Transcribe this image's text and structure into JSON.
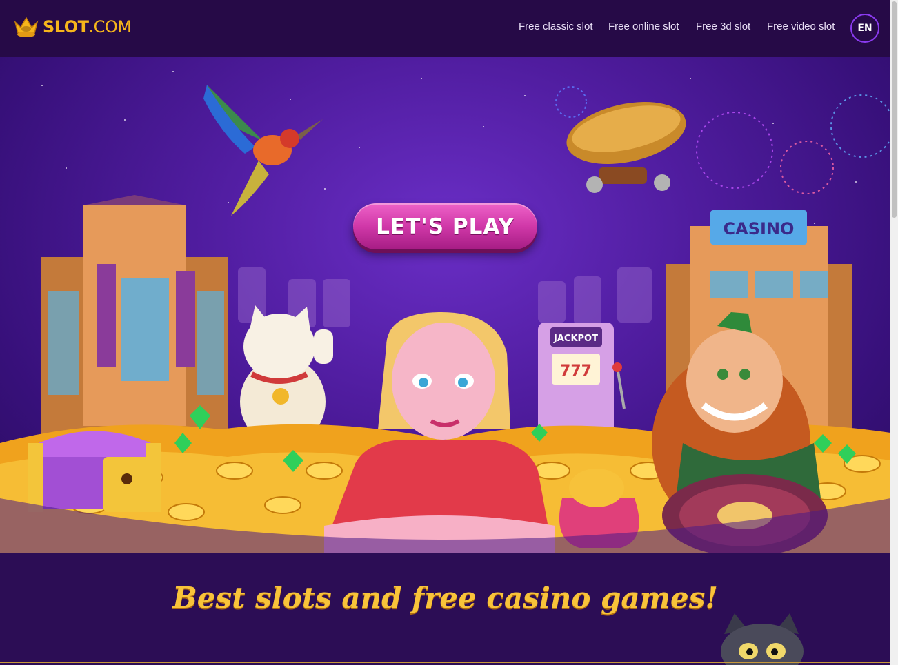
{
  "header": {
    "logo_text_bold": "SLOT",
    "logo_text_rest": ".COM",
    "nav": [
      {
        "label": "Free classic slot"
      },
      {
        "label": "Free online slot"
      },
      {
        "label": "Free 3d slot"
      },
      {
        "label": "Free video slot"
      }
    ],
    "language": "EN"
  },
  "hero": {
    "cta_label": "LET'S PLAY",
    "casino_sign": "CASINO",
    "jackpot_sign": "JACKPOT",
    "jackpot_reels": "777"
  },
  "tagline": "Best slots and free casino games!",
  "colors": {
    "brand_gold": "#f6b51b",
    "header_bg": "#260a47",
    "cta_pink": "#d038a8",
    "accent_purple": "#8b3bf0"
  },
  "icons": [
    "crown-icon"
  ]
}
